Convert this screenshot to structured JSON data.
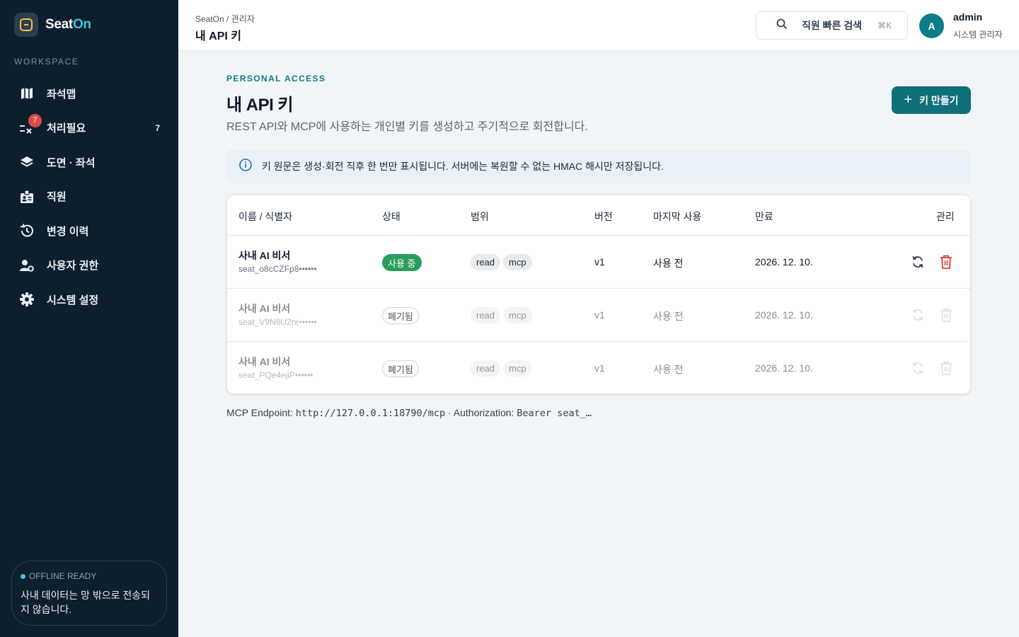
{
  "brand": {
    "name_part1": "Seat",
    "name_part2": "On"
  },
  "sidebar": {
    "section_label": "WORKSPACE",
    "items": [
      {
        "label": "좌석맵",
        "icon": "map-icon"
      },
      {
        "label": "처리필요",
        "icon": "tasks-icon",
        "badge": "7",
        "count": "7"
      },
      {
        "label": "도면 · 좌석",
        "icon": "layers-icon"
      },
      {
        "label": "직원",
        "icon": "id-badge-icon"
      },
      {
        "label": "변경 이력",
        "icon": "history-icon"
      },
      {
        "label": "사용자 권한",
        "icon": "user-gear-icon"
      },
      {
        "label": "시스템 설정",
        "icon": "gear-icon"
      }
    ],
    "offline": {
      "title": "OFFLINE READY",
      "text": "사내 데이터는 망 밖으로 전송되지 않습니다."
    }
  },
  "header": {
    "breadcrumb": "SeatOn / 관리자",
    "title": "내 API 키",
    "search_label": "직원 빠른 검색",
    "search_shortcut": "⌘K",
    "user": {
      "initial": "A",
      "name": "admin",
      "role": "시스템 관리자"
    }
  },
  "main": {
    "eyebrow": "PERSONAL ACCESS",
    "title": "내 API 키",
    "description": "REST API와 MCP에 사용하는 개인별 키를 생성하고 주기적으로 회전합니다.",
    "create_label": "키 만들기",
    "notice": "키 원문은 생성·회전 직후 한 번만 표시됩니다. 서버에는 복원할 수 없는 HMAC 해시만 저장됩니다."
  },
  "table": {
    "columns": [
      "이름 / 식별자",
      "상태",
      "범위",
      "버전",
      "마지막 사용",
      "만료",
      "관리"
    ],
    "rows": [
      {
        "name": "사내 AI 비서",
        "id": "seat_o8cCZFp8••••••",
        "status": "사용 중",
        "active": true,
        "scopes": [
          "read",
          "mcp"
        ],
        "version": "v1",
        "last_used": "사용 전",
        "expires": "2026. 12. 10."
      },
      {
        "name": "사내 AI 비서",
        "id": "seat_V9N8U2nr••••••",
        "status": "폐기됨",
        "active": false,
        "scopes": [
          "read",
          "mcp"
        ],
        "version": "v1",
        "last_used": "사용 전",
        "expires": "2026. 12. 10."
      },
      {
        "name": "사내 AI 비서",
        "id": "seat_PQe4ejiP••••••",
        "status": "폐기됨",
        "active": false,
        "scopes": [
          "read",
          "mcp"
        ],
        "version": "v1",
        "last_used": "사용 전",
        "expires": "2026. 12. 10."
      }
    ]
  },
  "footer": {
    "endpoint_label": "MCP Endpoint:",
    "endpoint_url": "http://127.0.0.1:18790/mcp",
    "auth_label": "· Authorization:",
    "auth_value": "Bearer seat_…"
  },
  "colors": {
    "sidebar_bg": "#0d1f2e",
    "accent": "#0f6f7a",
    "active_status": "#2a9d5c",
    "danger": "#d93a3a"
  }
}
